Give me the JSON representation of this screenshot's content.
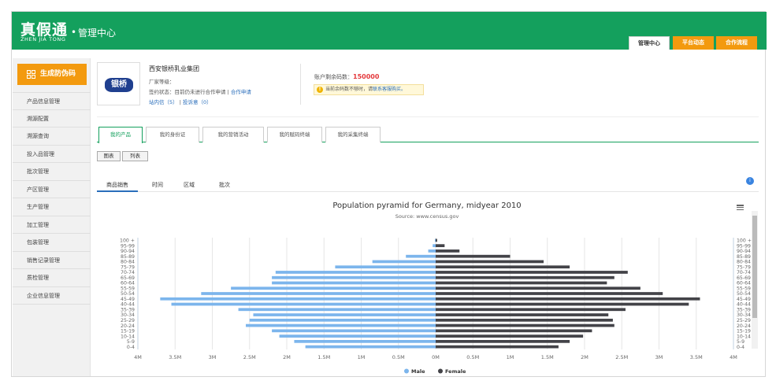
{
  "header": {
    "logo_main": "真假通",
    "logo_sub": "ZHEN JIA TONG",
    "logo_dot": "•",
    "logo_center": "管理中心",
    "tabs": [
      {
        "label": "管理中心",
        "active": true
      },
      {
        "label": "平台动态",
        "active": false
      },
      {
        "label": "合作流程",
        "active": false
      }
    ],
    "accent_green": "#14a05d",
    "accent_orange": "#f39a0f"
  },
  "sidebar": {
    "generate_button": "生成防伪码",
    "generate_icon": "grid-icon",
    "items": [
      {
        "label": "产品信息管理"
      },
      {
        "label": "溯源配置"
      },
      {
        "label": "溯源查询"
      },
      {
        "label": "投入品管理"
      },
      {
        "label": "批次管理"
      },
      {
        "label": "产区管理"
      },
      {
        "label": "生产管理"
      },
      {
        "label": "加工管理"
      },
      {
        "label": "包装管理"
      },
      {
        "label": "销售记录管理"
      },
      {
        "label": "质检管理"
      },
      {
        "label": "企业信息管理"
      }
    ]
  },
  "company": {
    "logo_text": "银桥",
    "name": "西安银桥乳业集团",
    "level_label": "厂家等级：",
    "status_label": "签约状态：目前仍未进行合作申请",
    "status_sep": "|",
    "apply_link": "合作申请",
    "inbox_link": "站内信（5）",
    "sep2": "|",
    "complaint_link": "投诉意（0）",
    "balance_label": "账户剩余码数：",
    "balance_value": "150000",
    "warning_icon": "warning-icon",
    "warning_text": "当前余码数不够时，请",
    "warning_link": "联系客服购买。"
  },
  "main_tabs": [
    {
      "label": "我的产品",
      "active": true
    },
    {
      "label": "我的身份证",
      "active": false
    },
    {
      "label": "我的营销活动",
      "active": false
    },
    {
      "label": "我的赋码终端",
      "active": false
    },
    {
      "label": "我的采集终端",
      "active": false
    }
  ],
  "view_toggle": {
    "chart": "图表",
    "table": "列表"
  },
  "sub_tabs": [
    {
      "label": "商品销售",
      "active": true
    },
    {
      "label": "时间",
      "active": false
    },
    {
      "label": "区域",
      "active": false
    },
    {
      "label": "批次",
      "active": false
    }
  ],
  "help_icon": "info-icon",
  "chart_data": {
    "type": "bar",
    "orientation": "horizontal-pyramid",
    "title": "Population pyramid for Germany, midyear 2010",
    "subtitle": "Source: www.census.gov",
    "categories": [
      "0-4",
      "5-9",
      "10-14",
      "15-19",
      "20-24",
      "25-29",
      "30-34",
      "35-39",
      "40-44",
      "45-49",
      "50-54",
      "55-59",
      "60-64",
      "65-69",
      "70-74",
      "75-79",
      "80-84",
      "85-89",
      "90-94",
      "95-99",
      "100 +"
    ],
    "series": [
      {
        "name": "Male",
        "color": "#7cb5ec",
        "values": [
          1.75,
          1.9,
          2.1,
          2.2,
          2.55,
          2.5,
          2.45,
          2.65,
          3.55,
          3.7,
          3.15,
          2.75,
          2.2,
          2.2,
          2.15,
          1.35,
          0.85,
          0.4,
          0.1,
          0.04,
          0.01
        ]
      },
      {
        "name": "Female",
        "color": "#434348",
        "values": [
          1.65,
          1.8,
          1.98,
          2.1,
          2.4,
          2.38,
          2.32,
          2.55,
          3.4,
          3.55,
          3.05,
          2.75,
          2.3,
          2.4,
          2.58,
          1.8,
          1.45,
          1.0,
          0.32,
          0.12,
          0.02
        ]
      }
    ],
    "xlim": [
      -4,
      4
    ],
    "x_ticks": [
      "4M",
      "3.5M",
      "3M",
      "2.5M",
      "2M",
      "1.5M",
      "1M",
      "0.5M",
      "0M",
      "0.5M",
      "1M",
      "1.5M",
      "2M",
      "2.5M",
      "3M",
      "3.5M",
      "4M"
    ],
    "x_tick_values": [
      -4,
      -3.5,
      -3,
      -2.5,
      -2,
      -1.5,
      -1,
      -0.5,
      0,
      0.5,
      1,
      1.5,
      2,
      2.5,
      3,
      3.5,
      4
    ],
    "legend_position": "bottom-center",
    "grid": true,
    "menu_icon": "menu-icon"
  }
}
